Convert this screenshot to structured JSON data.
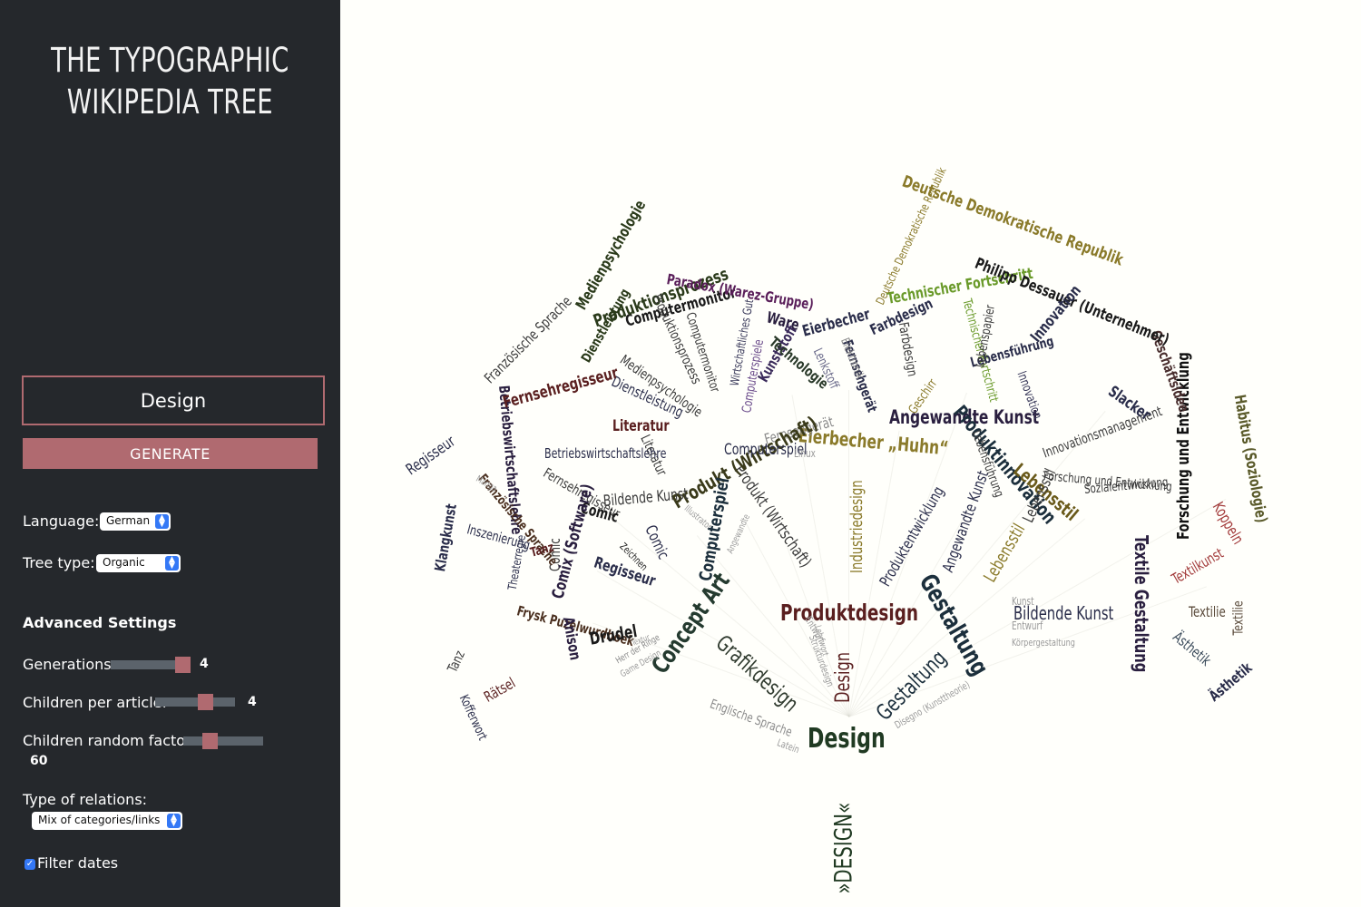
{
  "app": {
    "title_line1": "THE TYPOGRAPHIC",
    "title_line2": "WIKIPEDIA TREE"
  },
  "search": {
    "value": "Design",
    "placeholder": ""
  },
  "generate_label": "GENERATE",
  "language": {
    "label": "Language:",
    "value": "German"
  },
  "tree_type": {
    "label": "Tree type:",
    "value": "Organic"
  },
  "advanced": {
    "heading": "Advanced Settings",
    "generations": {
      "label": "Generations:",
      "value": "4",
      "fraction": 0.85
    },
    "children": {
      "label": "Children per article:",
      "value": "4",
      "fraction": 0.6
    },
    "random": {
      "label": "Children random factor:",
      "value": "60",
      "fraction": 0.35
    },
    "relations": {
      "label": "Type of relations:",
      "value": "Mix of categories/links"
    },
    "filter": {
      "label": "Filter dates",
      "checked": true
    }
  },
  "colors": {
    "sidebar_bg": "#25282c",
    "accent": "#b06a70",
    "select_chevron": "#3478f6",
    "canvas_bg": "#fffffb"
  },
  "tree_words": [
    {
      "text": "Design",
      "color": "#203a22",
      "weight": "bold"
    },
    {
      "text": "»DESIGN«",
      "color": "#203a22",
      "weight": "normal"
    },
    {
      "text": "Produktdesign",
      "color": "#5a1f1f",
      "weight": "bold"
    },
    {
      "text": "Gestaltung",
      "color": "#1c2f3c",
      "weight": "bold"
    },
    {
      "text": "Gestaltung",
      "color": "#1c2f3c",
      "weight": "normal"
    },
    {
      "text": "Grafikdesign",
      "color": "#2f3a2e",
      "weight": "normal"
    },
    {
      "text": "Concept Art",
      "color": "#243a2f",
      "weight": "bold"
    },
    {
      "text": "Design",
      "color": "#5a1f1f",
      "weight": "normal"
    },
    {
      "text": "Englische Sprache",
      "color": "#8a8a8a",
      "weight": "normal"
    },
    {
      "text": "Latein",
      "color": "#9a9a9a",
      "weight": "normal"
    },
    {
      "text": "Disegno (Kunsttheorie)",
      "color": "#9a9a9a",
      "weight": "normal"
    },
    {
      "text": "Bildende Kunst",
      "color": "#2a2d4a",
      "weight": "normal"
    },
    {
      "text": "Kunst",
      "color": "#9a9a9a",
      "weight": "normal"
    },
    {
      "text": "Entwurf",
      "color": "#9a9a9a",
      "weight": "normal"
    },
    {
      "text": "Körpergestaltung",
      "color": "#9a9a9a",
      "weight": "normal"
    },
    {
      "text": "Textile Gestaltung",
      "color": "#2a1f3f",
      "weight": "bold"
    },
    {
      "text": "Textilie",
      "color": "#5a4a3a",
      "weight": "normal"
    },
    {
      "text": "Textilie",
      "color": "#5a4a3a",
      "weight": "normal"
    },
    {
      "text": "Textilkunst",
      "color": "#a23a3a",
      "weight": "normal"
    },
    {
      "text": "Ästhetik",
      "color": "#3a4a5a",
      "weight": "normal"
    },
    {
      "text": "Ästhetik",
      "color": "#2a2d4a",
      "weight": "bold"
    },
    {
      "text": "Forschung und Entwicklung",
      "color": "#111111",
      "weight": "bold"
    },
    {
      "text": "Koppeln",
      "color": "#a23a3a",
      "weight": "normal"
    },
    {
      "text": "Habitus (Soziologie)",
      "color": "#5a5a2a",
      "weight": "bold"
    },
    {
      "text": "Geschäftsidee",
      "color": "#4a2f2f",
      "weight": "bold"
    },
    {
      "text": "Angewandte Kunst",
      "color": "#2a1f3f",
      "weight": "bold"
    },
    {
      "text": "Angewandte Kunst",
      "color": "#2a2d4a",
      "weight": "normal"
    },
    {
      "text": "Produktinnovation",
      "color": "#1c2f3c",
      "weight": "bold"
    },
    {
      "text": "Produktentwicklung",
      "color": "#2a2d4a",
      "weight": "normal"
    },
    {
      "text": "Lebensstil",
      "color": "#8a7a2a",
      "weight": "normal"
    },
    {
      "text": "Lebensstil",
      "color": "#6a5a1a",
      "weight": "bold"
    },
    {
      "text": "Lebensstil",
      "color": "#3a3a3a",
      "weight": "normal"
    },
    {
      "text": "Industriedesign",
      "color": "#8a7a2a",
      "weight": "normal"
    },
    {
      "text": "Eierbecher „Huhn“",
      "color": "#8a7a2a",
      "weight": "bold"
    },
    {
      "text": "Eierbecher",
      "color": "#2a2d4a",
      "weight": "bold"
    },
    {
      "text": "Fernsehgerät",
      "color": "#8a8a8a",
      "weight": "normal"
    },
    {
      "text": "Fernsehgerät",
      "color": "#2a2d4a",
      "weight": "bold"
    },
    {
      "text": "Produkt (Wirtschaft)",
      "color": "#3a3a3a",
      "weight": "normal"
    },
    {
      "text": "Produkt (Wirtschaft)",
      "color": "#3a3a1a",
      "weight": "bold"
    },
    {
      "text": "Computerspiel",
      "color": "#1c2f3c",
      "weight": "bold"
    },
    {
      "text": "Computerspiel",
      "color": "#2a2d4a",
      "weight": "normal"
    },
    {
      "text": "Computerspiele",
      "color": "#6a4a8a",
      "weight": "normal"
    },
    {
      "text": "Computermonitor",
      "color": "#3a3a3a",
      "weight": "normal"
    },
    {
      "text": "Computermonitor",
      "color": "#1a1a1a",
      "weight": "bold"
    },
    {
      "text": "Produktionsprozess",
      "color": "#2a3a1a",
      "weight": "bold"
    },
    {
      "text": "Produktionsprozess",
      "color": "#3a3a3a",
      "weight": "normal"
    },
    {
      "text": "Paradox (Warez-Gruppe)",
      "color": "#5a1f5a",
      "weight": "bold"
    },
    {
      "text": "Ware",
      "color": "#2a1f3f",
      "weight": "bold"
    },
    {
      "text": "Wirtschaftliches Gut",
      "color": "#3a3a5a",
      "weight": "normal"
    },
    {
      "text": "Kunststoff",
      "color": "#3a2a5a",
      "weight": "bold"
    },
    {
      "text": "Technologie",
      "color": "#2a3a2a",
      "weight": "bold"
    },
    {
      "text": "Lenkstoff",
      "color": "#6a6a8a",
      "weight": "normal"
    },
    {
      "text": "Elektronik",
      "color": "#8a8a8a",
      "weight": "normal"
    },
    {
      "text": "Farbdesign",
      "color": "#2a2d4a",
      "weight": "bold"
    },
    {
      "text": "Farbdesign",
      "color": "#3a3a3a",
      "weight": "normal"
    },
    {
      "text": "Technischer Fortschritt",
      "color": "#6a9a2a",
      "weight": "bold"
    },
    {
      "text": "Technischer Fortschritt",
      "color": "#6a9a2a",
      "weight": "normal"
    },
    {
      "text": "Deutsche Demokratische Republik",
      "color": "#8a7a2a",
      "weight": "bold"
    },
    {
      "text": "Deutsche Demokratische Republik",
      "color": "#8a7a2a",
      "weight": "normal"
    },
    {
      "text": "Philipp Dessauer (Unternehmer)",
      "color": "#1a1a1a",
      "weight": "bold"
    },
    {
      "text": "Lebensführung",
      "color": "#2a2d4a",
      "weight": "bold"
    },
    {
      "text": "Innovation",
      "color": "#2a2d4a",
      "weight": "bold"
    },
    {
      "text": "Innovation",
      "color": "#3a3a5a",
      "weight": "normal"
    },
    {
      "text": "Innovationsmanagement",
      "color": "#3a3a3a",
      "weight": "normal"
    },
    {
      "text": "Lebenspapier",
      "color": "#3a3a3a",
      "weight": "normal"
    },
    {
      "text": "Lebensführung",
      "color": "#3a3a3a",
      "weight": "normal"
    },
    {
      "text": "Sozialentwicklung",
      "color": "#3a3a3a",
      "weight": "normal"
    },
    {
      "text": "Forschung und Entwicklung",
      "color": "#3a3a3a",
      "weight": "normal"
    },
    {
      "text": "Slacker",
      "color": "#2a2d4a",
      "weight": "bold"
    },
    {
      "text": "Geschirr",
      "color": "#8a7a2a",
      "weight": "normal"
    },
    {
      "text": "Dienstleistung",
      "color": "#2a2d4a",
      "weight": "normal"
    },
    {
      "text": "Dienstleistung",
      "color": "#2a3a1a",
      "weight": "bold"
    },
    {
      "text": "Medienpsychologie",
      "color": "#3a3a3a",
      "weight": "normal"
    },
    {
      "text": "Medienpsychologie",
      "color": "#2a3a1a",
      "weight": "bold"
    },
    {
      "text": "Literatur",
      "color": "#5a1f1f",
      "weight": "bold"
    },
    {
      "text": "Literatur",
      "color": "#3a3a3a",
      "weight": "normal"
    },
    {
      "text": "Betriebswirtschaftslehre",
      "color": "#2a2d4a",
      "weight": "normal"
    },
    {
      "text": "Betriebswirtschaftslehre",
      "color": "#2a1f3f",
      "weight": "bold"
    },
    {
      "text": "Fernsehregisseur",
      "color": "#5a1f1f",
      "weight": "bold"
    },
    {
      "text": "Fernsehregisseur",
      "color": "#3a3a3a",
      "weight": "normal"
    },
    {
      "text": "Bildende Kunst",
      "color": "#3a3a3a",
      "weight": "normal"
    },
    {
      "text": "Comic",
      "color": "#1a1a1a",
      "weight": "bold"
    },
    {
      "text": "Comic",
      "color": "#2a2d4a",
      "weight": "normal"
    },
    {
      "text": "Comic",
      "color": "#3a3a3a",
      "weight": "normal"
    },
    {
      "text": "Comix (Software)",
      "color": "#2a1f3f",
      "weight": "bold"
    },
    {
      "text": "Regisseur",
      "color": "#2a2d4a",
      "weight": "bold"
    },
    {
      "text": "Regisseur",
      "color": "#2a2d4a",
      "weight": "normal"
    },
    {
      "text": "Französische Sprache",
      "color": "#4a2f1f",
      "weight": "bold"
    },
    {
      "text": "Französische Sprache",
      "color": "#3a3a3a",
      "weight": "normal"
    },
    {
      "text": "Klangkunst",
      "color": "#2a2d4a",
      "weight": "bold"
    },
    {
      "text": "Inszenierung",
      "color": "#2a2d4a",
      "weight": "normal"
    },
    {
      "text": "Theaterregie",
      "color": "#2a2d4a",
      "weight": "normal"
    },
    {
      "text": "Tanz",
      "color": "#5a1f1f",
      "weight": "bold"
    },
    {
      "text": "Tanz",
      "color": "#3a3a3a",
      "weight": "normal"
    },
    {
      "text": "Frysk Puzelwurdboek",
      "color": "#4a2f1f",
      "weight": "bold"
    },
    {
      "text": "Rätsel",
      "color": "#5a1f1f",
      "weight": "normal"
    },
    {
      "text": "Kofferwort",
      "color": "#2a2d4a",
      "weight": "normal"
    },
    {
      "text": "Anison",
      "color": "#2a1f3f",
      "weight": "bold"
    },
    {
      "text": "Drudel",
      "color": "#1a1a1a",
      "weight": "bold"
    },
    {
      "text": "Zeichnen",
      "color": "#1a1a1a",
      "weight": "normal"
    },
    {
      "text": "Herr der Ringe",
      "color": "#8a8a8a",
      "weight": "normal"
    },
    {
      "text": "Game Design",
      "color": "#9a9a9a",
      "weight": "normal"
    },
    {
      "text": "Textur",
      "color": "#9a9a9a",
      "weight": "normal"
    },
    {
      "text": "Entwurf",
      "color": "#9a9a9a",
      "weight": "normal"
    },
    {
      "text": "Strukturdesign",
      "color": "#9a9a9a",
      "weight": "normal"
    },
    {
      "text": "Lehnwort",
      "color": "#9a9a9a",
      "weight": "normal"
    },
    {
      "text": "Angewandte",
      "color": "#9a9a9a",
      "weight": "normal"
    },
    {
      "text": "Illustrator",
      "color": "#9a9a9a",
      "weight": "normal"
    },
    {
      "text": "Manga",
      "color": "#9a9a9a",
      "weight": "normal"
    },
    {
      "text": "Linux",
      "color": "#9a9a9a",
      "weight": "normal"
    }
  ]
}
